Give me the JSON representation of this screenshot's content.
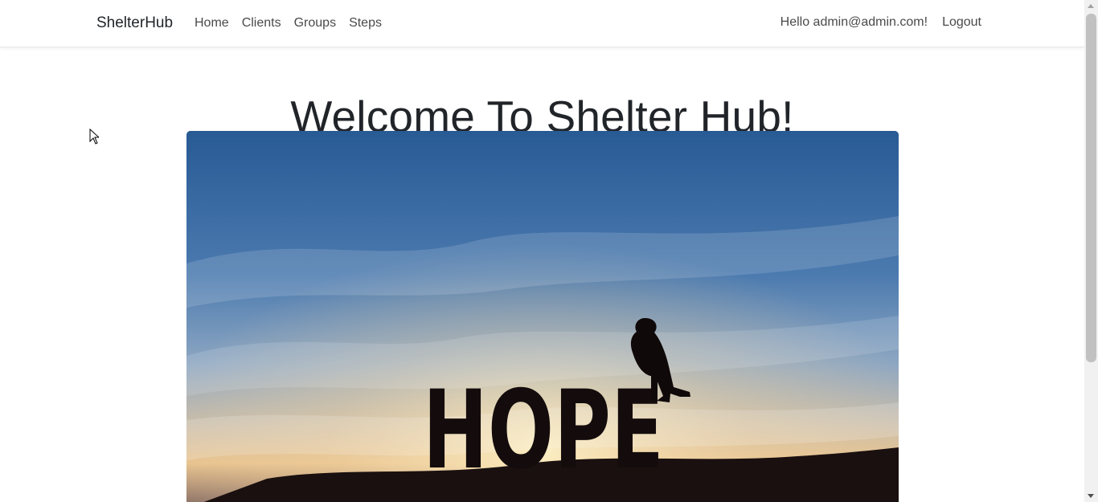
{
  "nav": {
    "brand": "ShelterHub",
    "links": [
      "Home",
      "Clients",
      "Groups",
      "Steps"
    ],
    "greeting": "Hello admin@admin.com!",
    "logout": "Logout"
  },
  "main": {
    "title": "Welcome To Shelter Hub!",
    "image_text": "HOPE"
  },
  "colors": {
    "text": "#212529",
    "nav_text": "#4a4a4a",
    "sky_top": "#2f5d92",
    "horizon": "#e3c093"
  }
}
